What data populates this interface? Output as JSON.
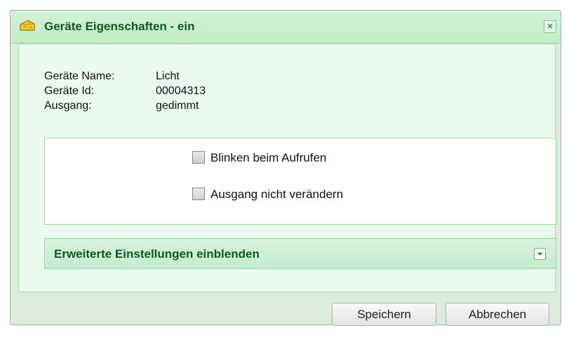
{
  "dialog": {
    "title": "Geräte Eigenschaften - ein",
    "icon": "cheese-icon",
    "close_label": "×"
  },
  "device_info": [
    {
      "label": "Geräte Name:",
      "value": "Licht"
    },
    {
      "label": "Geräte Id:",
      "value": "00004313"
    },
    {
      "label": "Ausgang:",
      "value": "gedimmt"
    }
  ],
  "options": [
    {
      "label": "Blinken beim Aufrufen",
      "checked": false
    },
    {
      "label": "Ausgang nicht verändern",
      "checked": false
    }
  ],
  "advanced": {
    "label": "Erweiterte Einstellungen einblenden",
    "icon": "chevron-down-icon"
  },
  "buttons": {
    "save": "Speichern",
    "cancel": "Abbrechen"
  },
  "colors": {
    "title_text": "#0f5a23",
    "dialog_bg": "#dcebdc",
    "content_bg": "#ebfaee",
    "accent_border": "#93dca0"
  }
}
